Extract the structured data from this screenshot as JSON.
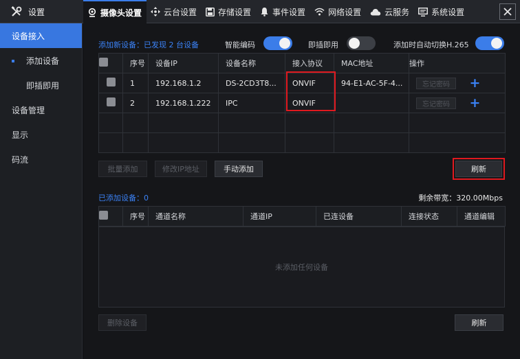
{
  "brand": {
    "title": "设置",
    "icon": "tools-icon"
  },
  "tabs": [
    {
      "label": "摄像头设置",
      "icon": "camera-icon"
    },
    {
      "label": "云台设置",
      "icon": "ptz-icon"
    },
    {
      "label": "存储设置",
      "icon": "save-icon"
    },
    {
      "label": "事件设置",
      "icon": "bell-icon"
    },
    {
      "label": "网络设置",
      "icon": "wifi-icon"
    },
    {
      "label": "云服务",
      "icon": "cloud-icon"
    },
    {
      "label": "系统设置",
      "icon": "monitor-icon"
    }
  ],
  "sidebar": {
    "items": [
      {
        "label": "设备接入"
      },
      {
        "label": "添加设备"
      },
      {
        "label": "即插即用"
      },
      {
        "label": "设备管理"
      },
      {
        "label": "显示"
      },
      {
        "label": "码流"
      }
    ]
  },
  "add_section": {
    "header": "添加新设备：已发现 2 台设备",
    "smart_encode_label": "智能编码",
    "smart_encode_on": true,
    "plug_play_label": "即插即用",
    "plug_play_on": false,
    "h265_label": "添加时自动切换H.265",
    "h265_on": true,
    "columns": [
      "序号",
      "设备IP",
      "设备名称",
      "接入协议",
      "MAC地址",
      "操作"
    ],
    "rows": [
      {
        "index": "1",
        "ip": "192.168.1.2",
        "name": "DS-2CD3T8...",
        "protocol": "ONVIF",
        "mac": "94-E1-AC-5F-4...",
        "action_btn": "忘记密码"
      },
      {
        "index": "2",
        "ip": "192.168.1.222",
        "name": "IPC",
        "protocol": "ONVIF",
        "mac": "",
        "action_btn": "忘记密码"
      }
    ],
    "batch_add": "批量添加",
    "modify_ip": "修改IP地址",
    "manual_add": "手动添加",
    "refresh": "刷新"
  },
  "added_section": {
    "header": "已添加设备：0",
    "bandwidth": "剩余带宽：320.00Mbps",
    "columns": [
      "序号",
      "通道名称",
      "通道IP",
      "已连设备",
      "连接状态",
      "通道编辑"
    ],
    "empty_text": "未添加任何设备",
    "delete": "删除设备",
    "refresh": "刷新"
  },
  "colors": {
    "accent": "#3b7de9",
    "highlight_box": "#e0191f"
  }
}
